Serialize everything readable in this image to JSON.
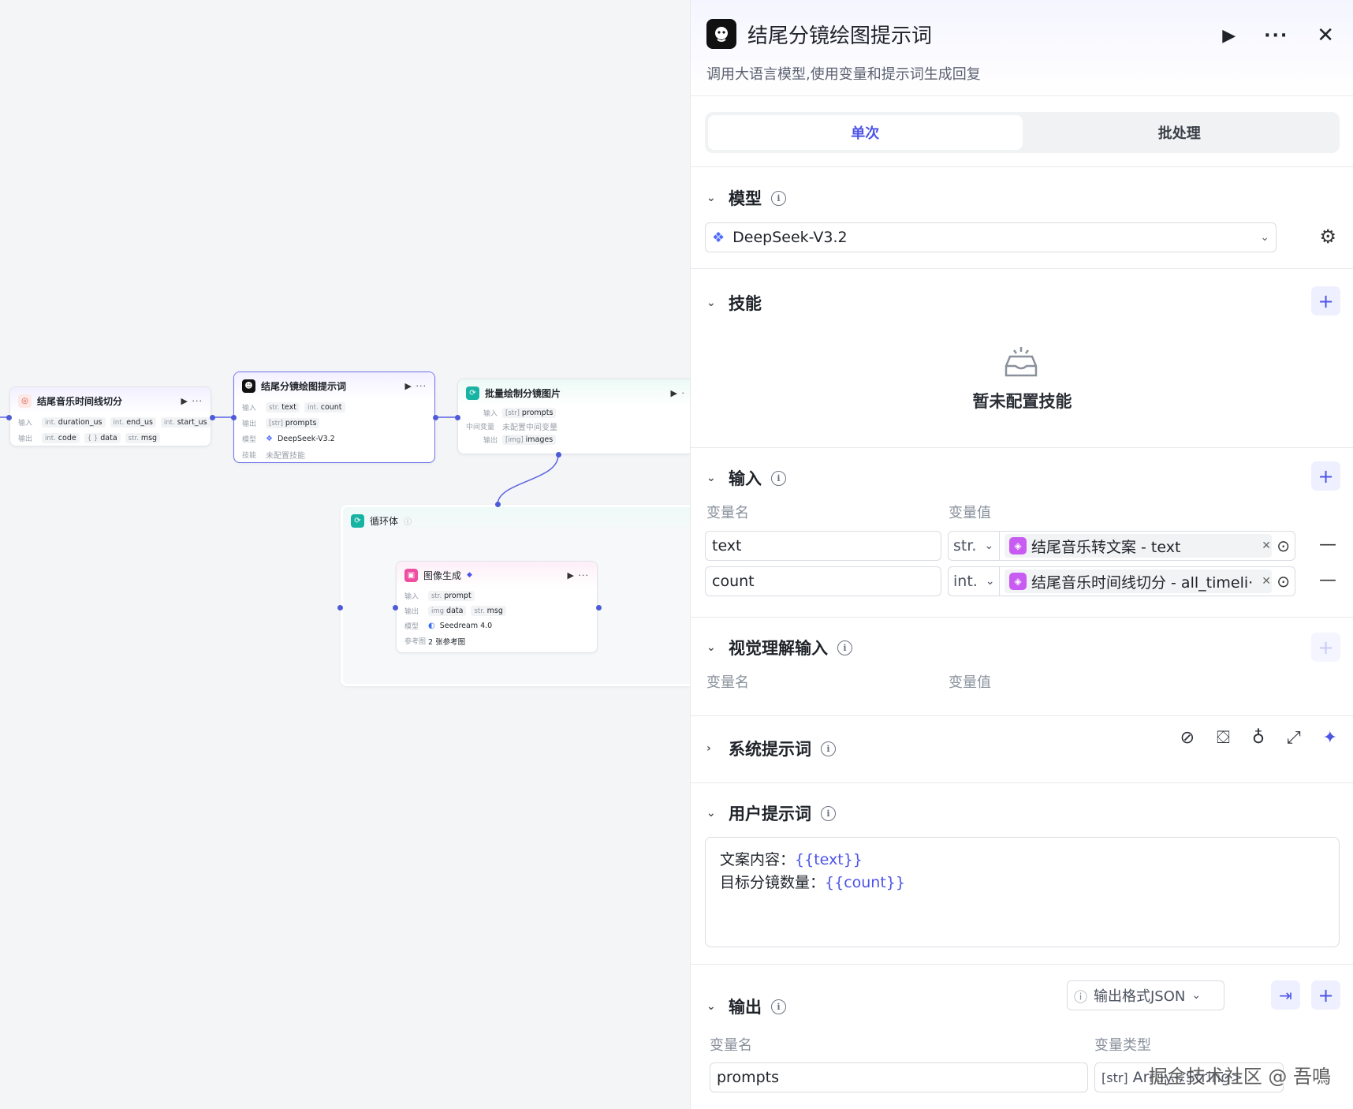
{
  "canvas": {
    "node1": {
      "title": "结尾音乐时间线切分",
      "in_label": "输入",
      "out_label": "输出",
      "inputs": [
        {
          "type": "int.",
          "name": "duration_us"
        },
        {
          "type": "int.",
          "name": "end_us"
        },
        {
          "type": "int.",
          "name": "start_us"
        }
      ],
      "outputs": [
        {
          "type": "int.",
          "name": "code"
        },
        {
          "type": "{ }",
          "name": "data"
        },
        {
          "type": "str.",
          "name": "msg"
        }
      ]
    },
    "node2": {
      "title": "结尾分镜绘图提示词",
      "in_label": "输入",
      "out_label": "输出",
      "model_label": "模型",
      "skill_label": "技能",
      "inputs": [
        {
          "type": "str.",
          "name": "text"
        },
        {
          "type": "int.",
          "name": "count"
        }
      ],
      "outputs": [
        {
          "type": "[str]",
          "name": "prompts"
        }
      ],
      "model": "DeepSeek-V3.2",
      "skill": "未配置技能"
    },
    "node3": {
      "title": "批量绘制分镜图片",
      "in_label": "输入",
      "mid_label": "中间变量",
      "out_label": "输出",
      "inputs": [
        {
          "type": "[str]",
          "name": "prompts"
        }
      ],
      "mid": "未配置中间变量",
      "outputs": [
        {
          "type": "[img]",
          "name": "images"
        }
      ]
    },
    "loop": {
      "title": "循环体"
    },
    "node4": {
      "title": "图像生成",
      "in_label": "输入",
      "out_label": "输出",
      "model_label": "模型",
      "ref_label": "参考图",
      "inputs": [
        {
          "type": "str.",
          "name": "prompt"
        }
      ],
      "outputs": [
        {
          "type": "img",
          "name": "data"
        },
        {
          "type": "str.",
          "name": "msg"
        }
      ],
      "model": "Seedream 4.0",
      "ref": "2 张参考图"
    }
  },
  "panel": {
    "title": "结尾分镜绘图提示词",
    "description": "调用大语言模型,使用变量和提示词生成回复",
    "tabs": [
      "单次",
      "批处理"
    ],
    "model": {
      "label": "模型",
      "value": "DeepSeek-V3.2"
    },
    "skills": {
      "label": "技能",
      "empty": "暂未配置技能"
    },
    "inputs": {
      "label": "输入",
      "col_name": "变量名",
      "col_value": "变量值",
      "rows": [
        {
          "name": "text",
          "type": "str.",
          "ref": "结尾音乐转文案 - text"
        },
        {
          "name": "count",
          "type": "int.",
          "ref": "结尾音乐时间线切分 - all_timeli···"
        }
      ]
    },
    "vision": {
      "label": "视觉理解输入",
      "col_name": "变量名",
      "col_value": "变量值"
    },
    "system_prompt": {
      "label": "系统提示词"
    },
    "user_prompt": {
      "label": "用户提示词",
      "line1_label": "文案内容：",
      "line1_var": "{{text}}",
      "line2_label": "目标分镜数量：",
      "line2_var": "{{count}}"
    },
    "output": {
      "label": "输出",
      "format": "输出格式JSON",
      "col_name": "变量名",
      "col_type": "变量类型",
      "rows": [
        {
          "name": "prompts",
          "type_icon": "[str]",
          "type": "Array<String>"
        }
      ]
    }
  },
  "watermark": "掘金技术社区 @ 吾鳴",
  "colors": {
    "accent": "#4d54e6",
    "wire": "#5b63e0"
  }
}
